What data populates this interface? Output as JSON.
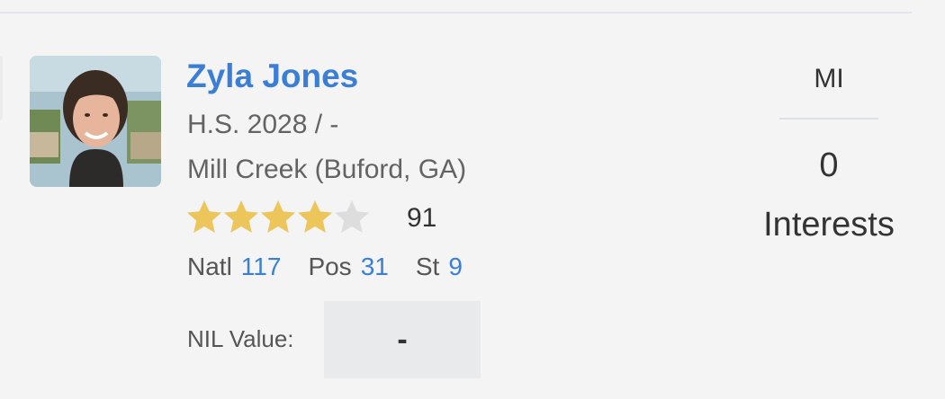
{
  "player": {
    "name": "Zyla Jones",
    "class_line": "H.S. 2028 / -",
    "school_line": "Mill Creek (Buford, GA)",
    "stars": 4,
    "stars_max": 5,
    "rating": "91",
    "ranks": {
      "natl_label": "Natl",
      "natl_value": "117",
      "pos_label": "Pos",
      "pos_value": "31",
      "st_label": "St",
      "st_value": "9"
    },
    "nil": {
      "label": "NIL Value:",
      "value": "-"
    }
  },
  "side": {
    "state": "MI",
    "interest_count": "0",
    "interest_label": "Interests"
  },
  "colors": {
    "accent": "#3a7ed6",
    "star_filled": "#ecc55b",
    "star_empty": "#dddddd"
  },
  "icons": {
    "star": "star-icon"
  }
}
